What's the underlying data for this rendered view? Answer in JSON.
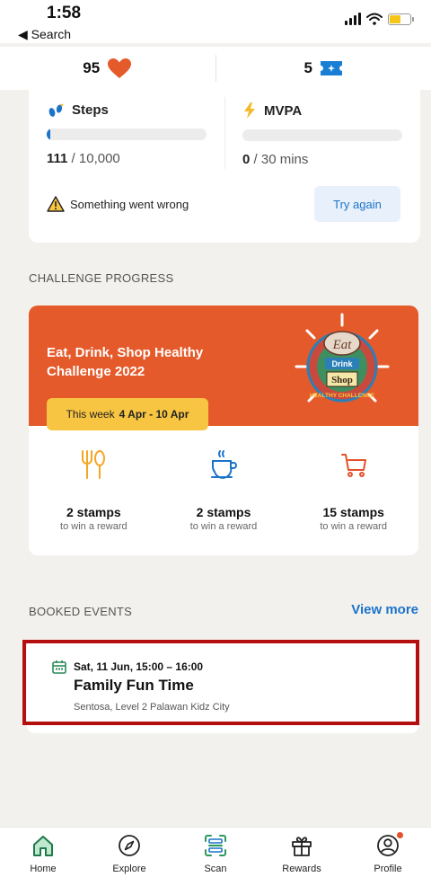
{
  "status_bar": {
    "time": "1:58",
    "back_label": "◀ Search"
  },
  "stats": {
    "hearts": "95",
    "tickets": "5"
  },
  "activity": {
    "steps": {
      "label": "Steps",
      "value": "111",
      "goal": "/ 10,000",
      "progress": 0.011
    },
    "mvpa": {
      "label": "MVPA",
      "value": "0",
      "goal": "/ 30 mins",
      "progress": 0
    },
    "error_text": "Something went wrong",
    "retry_label": "Try again"
  },
  "challenge_section": {
    "title": "CHALLENGE PROGRESS",
    "challenge_name": "Eat, Drink, Shop Healthy Challenge 2022",
    "week_prefix": "This week",
    "week_range": "4 Apr - 10 Apr",
    "badge_texts": {
      "top": "Eat",
      "middle": "Drink",
      "lower": "Shop",
      "bottom": "HEALTHY CHALLENGE"
    },
    "stamps": [
      {
        "icon": "utensils-icon",
        "count": "2 stamps",
        "sub": "to win a reward"
      },
      {
        "icon": "coffee-cup-icon",
        "count": "2 stamps",
        "sub": "to win a reward"
      },
      {
        "icon": "cart-icon",
        "count": "15 stamps",
        "sub": "to win a reward"
      }
    ],
    "accent_color": "#e55a2a",
    "pill_color": "#f8c542"
  },
  "booked_events": {
    "title": "BOOKED EVENTS",
    "view_more": "View more",
    "event": {
      "date": "Sat, 11 Jun, 15:00 – 16:00",
      "name": "Family Fun Time",
      "location": "Sentosa, Level 2 Palawan Kidz City"
    }
  },
  "tabs": [
    {
      "icon": "home-icon",
      "label": "Home"
    },
    {
      "icon": "compass-icon",
      "label": "Explore"
    },
    {
      "icon": "scan-icon",
      "label": "Scan"
    },
    {
      "icon": "gift-icon",
      "label": "Rewards"
    },
    {
      "icon": "profile-icon",
      "label": "Profile"
    }
  ]
}
